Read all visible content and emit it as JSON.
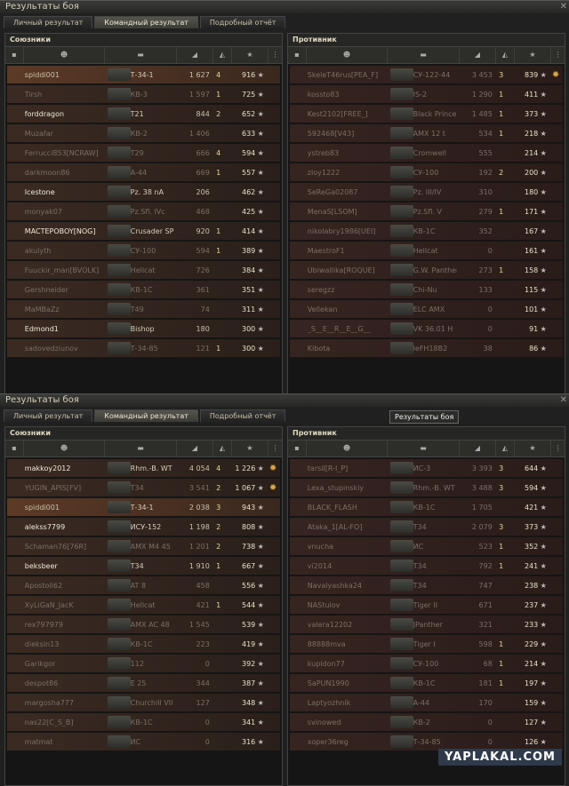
{
  "window_title": "Результаты боя",
  "tabs": [
    "Личный результат",
    "Командный результат",
    "Подробный отчёт"
  ],
  "allies_label": "Союзники",
  "enemies_label": "Противник",
  "tooltip": "Результаты боя",
  "watermark": "YAPLAKAL.COM",
  "battles": [
    {
      "allies": [
        {
          "name": "spiddi001",
          "tank": "Т-34-1",
          "dmg": "1 627",
          "kills": "4",
          "xp": "916",
          "state": "me"
        },
        {
          "name": "Tirsh",
          "tank": "КВ-3",
          "dmg": "1 597",
          "kills": "1",
          "xp": "725",
          "state": "dead"
        },
        {
          "name": "forddragon",
          "tank": "T21",
          "dmg": "844",
          "kills": "2",
          "xp": "652",
          "state": "alive"
        },
        {
          "name": "Muzafar",
          "tank": "КВ-2",
          "dmg": "1 406",
          "kills": "",
          "xp": "633",
          "state": "dead"
        },
        {
          "name": "Ferrucci853[NCRAW]",
          "tank": "T29",
          "dmg": "666",
          "kills": "4",
          "xp": "594",
          "state": "dead"
        },
        {
          "name": "darkmoon86",
          "tank": "A-44",
          "dmg": "669",
          "kills": "1",
          "xp": "557",
          "state": "dead"
        },
        {
          "name": "Icestone",
          "tank": "Pz. 38 nA",
          "dmg": "206",
          "kills": "",
          "xp": "462",
          "state": "alive"
        },
        {
          "name": "monyak07",
          "tank": "Pz.Sfl. IVc",
          "dmg": "468",
          "kills": "",
          "xp": "425",
          "state": "dead"
        },
        {
          "name": "MACTEPOBOY[NOG]",
          "tank": "Crusader SP",
          "dmg": "920",
          "kills": "1",
          "xp": "414",
          "state": "alive"
        },
        {
          "name": "akulyth",
          "tank": "СУ-100",
          "dmg": "594",
          "kills": "1",
          "xp": "389",
          "state": "dead"
        },
        {
          "name": "Fuuckir_man[BVOLK]",
          "tank": "Hellcat",
          "dmg": "726",
          "kills": "",
          "xp": "384",
          "state": "dead"
        },
        {
          "name": "Gershneider",
          "tank": "КВ-1С",
          "dmg": "361",
          "kills": "",
          "xp": "351",
          "state": "dead"
        },
        {
          "name": "MaMBaZz",
          "tank": "T49",
          "dmg": "74",
          "kills": "",
          "xp": "311",
          "state": "dead"
        },
        {
          "name": "Edmond1",
          "tank": "Bishop",
          "dmg": "180",
          "kills": "",
          "xp": "300",
          "state": "alive"
        },
        {
          "name": "sadovedziunov",
          "tank": "Т-34-85",
          "dmg": "121",
          "kills": "1",
          "xp": "300",
          "state": "dead"
        }
      ],
      "enemies": [
        {
          "name": "SkeleT46rus[PEA_F]",
          "tank": "СУ-122-44",
          "dmg": "3 453",
          "kills": "3",
          "xp": "839",
          "state": "dead",
          "medal": true
        },
        {
          "name": "kossto83",
          "tank": "IS-2",
          "dmg": "1 290",
          "kills": "1",
          "xp": "411",
          "state": "dead"
        },
        {
          "name": "Kest2102[FREE_]",
          "tank": "Black Prince",
          "dmg": "1 485",
          "kills": "1",
          "xp": "373",
          "state": "dead"
        },
        {
          "name": "592468[V43]",
          "tank": "AMX 12 t",
          "dmg": "534",
          "kills": "1",
          "xp": "218",
          "state": "dead"
        },
        {
          "name": "ystreb83",
          "tank": "Cromwell",
          "dmg": "555",
          "kills": "",
          "xp": "214",
          "state": "dead"
        },
        {
          "name": "zloy1222",
          "tank": "СУ-100",
          "dmg": "192",
          "kills": "2",
          "xp": "200",
          "state": "dead"
        },
        {
          "name": "SeReGa02087",
          "tank": "Pz. III/IV",
          "dmg": "310",
          "kills": "",
          "xp": "180",
          "state": "dead"
        },
        {
          "name": "MenaS[LSOM]",
          "tank": "Pz.Sfl. V",
          "dmg": "279",
          "kills": "1",
          "xp": "171",
          "state": "dead"
        },
        {
          "name": "nikolabry1986[UEI]",
          "tank": "КВ-1С",
          "dmg": "352",
          "kills": "",
          "xp": "167",
          "state": "dead"
        },
        {
          "name": "MaestroF1",
          "tank": "Hellcat",
          "dmg": "0",
          "kills": "",
          "xp": "161",
          "state": "dead"
        },
        {
          "name": "Ubiwallika[ROQUE]",
          "tank": "G.W. Panther",
          "dmg": "273",
          "kills": "1",
          "xp": "158",
          "state": "dead"
        },
        {
          "name": "seregzz",
          "tank": "Chi-Nu",
          "dmg": "133",
          "kills": "",
          "xp": "115",
          "state": "dead"
        },
        {
          "name": "Vellekan",
          "tank": "ELC AMX",
          "dmg": "0",
          "kills": "",
          "xp": "101",
          "state": "dead"
        },
        {
          "name": "_S__E__R__E__G__",
          "tank": "VK 36.01 H",
          "dmg": "0",
          "kills": "",
          "xp": "91",
          "state": "dead"
        },
        {
          "name": "Kibota",
          "tank": "leFH18B2",
          "dmg": "38",
          "kills": "",
          "xp": "86",
          "state": "dead"
        }
      ]
    },
    {
      "allies": [
        {
          "name": "makkoy2012",
          "tank": "Rhm.-B. WT",
          "dmg": "4 054",
          "kills": "4",
          "xp": "1 226",
          "state": "alive",
          "medal": true
        },
        {
          "name": "YUGIN_APIS[FV]",
          "tank": "T34",
          "dmg": "3 541",
          "kills": "2",
          "xp": "1 067",
          "state": "dead",
          "medal": true
        },
        {
          "name": "spiddi001",
          "tank": "Т-34-1",
          "dmg": "2 038",
          "kills": "3",
          "xp": "943",
          "state": "me"
        },
        {
          "name": "alekss7799",
          "tank": "ИСУ-152",
          "dmg": "1 198",
          "kills": "2",
          "xp": "808",
          "state": "alive"
        },
        {
          "name": "Schaman76[76R]",
          "tank": "AMX M4 45",
          "dmg": "1 201",
          "kills": "2",
          "xp": "738",
          "state": "dead"
        },
        {
          "name": "beksbeer",
          "tank": "T34",
          "dmg": "1 910",
          "kills": "1",
          "xp": "667",
          "state": "alive"
        },
        {
          "name": "Apostoll62",
          "tank": "AT 8",
          "dmg": "458",
          "kills": "",
          "xp": "556",
          "state": "dead"
        },
        {
          "name": "XyLiGaN_JacK",
          "tank": "Hellcat",
          "dmg": "421",
          "kills": "1",
          "xp": "544",
          "state": "dead"
        },
        {
          "name": "rex797979",
          "tank": "AMX AC 48",
          "dmg": "1 545",
          "kills": "",
          "xp": "539",
          "state": "dead"
        },
        {
          "name": "dieksin13",
          "tank": "КВ-1С",
          "dmg": "223",
          "kills": "",
          "xp": "419",
          "state": "dead"
        },
        {
          "name": "Garikgor",
          "tank": "112",
          "dmg": "0",
          "kills": "",
          "xp": "392",
          "state": "dead"
        },
        {
          "name": "despot86",
          "tank": "E 25",
          "dmg": "344",
          "kills": "",
          "xp": "387",
          "state": "dead"
        },
        {
          "name": "margosha777",
          "tank": "Churchill VII",
          "dmg": "127",
          "kills": "",
          "xp": "348",
          "state": "dead"
        },
        {
          "name": "nas22[C_S_B]",
          "tank": "КВ-1С",
          "dmg": "0",
          "kills": "",
          "xp": "341",
          "state": "dead"
        },
        {
          "name": "matmat",
          "tank": "ИС",
          "dmg": "0",
          "kills": "",
          "xp": "316",
          "state": "dead"
        }
      ],
      "enemies": [
        {
          "name": "tarsil[R-I_P]",
          "tank": "ИС-3",
          "dmg": "3 393",
          "kills": "3",
          "xp": "644",
          "state": "dead"
        },
        {
          "name": "Lexa_stupinskiy",
          "tank": "Rhm.-B. WT",
          "dmg": "3 488",
          "kills": "3",
          "xp": "594",
          "state": "dead"
        },
        {
          "name": "BLACK_FLASH",
          "tank": "КВ-1С",
          "dmg": "1 705",
          "kills": "",
          "xp": "421",
          "state": "dead"
        },
        {
          "name": "Ataka_1[AL-FO]",
          "tank": "T34",
          "dmg": "2 079",
          "kills": "3",
          "xp": "373",
          "state": "dead"
        },
        {
          "name": "vnucha",
          "tank": "ИС",
          "dmg": "523",
          "kills": "1",
          "xp": "352",
          "state": "dead"
        },
        {
          "name": "vi2014",
          "tank": "T34",
          "dmg": "792",
          "kills": "1",
          "xp": "241",
          "state": "dead"
        },
        {
          "name": "Navalyashka24",
          "tank": "T34",
          "dmg": "747",
          "kills": "",
          "xp": "238",
          "state": "dead"
        },
        {
          "name": "NAStulov",
          "tank": "Tiger II",
          "dmg": "671",
          "kills": "",
          "xp": "237",
          "state": "dead"
        },
        {
          "name": "valera12202",
          "tank": "JPanther",
          "dmg": "321",
          "kills": "",
          "xp": "233",
          "state": "dead"
        },
        {
          "name": "88888mva",
          "tank": "Tiger I",
          "dmg": "598",
          "kills": "1",
          "xp": "229",
          "state": "dead"
        },
        {
          "name": "kupidon77",
          "tank": "СУ-100",
          "dmg": "68",
          "kills": "1",
          "xp": "214",
          "state": "dead"
        },
        {
          "name": "SaPUN1990",
          "tank": "КВ-1С",
          "dmg": "181",
          "kills": "1",
          "xp": "197",
          "state": "dead"
        },
        {
          "name": "Laptyozhnik",
          "tank": "A-44",
          "dmg": "170",
          "kills": "",
          "xp": "159",
          "state": "dead"
        },
        {
          "name": "svinowed",
          "tank": "КВ-2",
          "dmg": "0",
          "kills": "",
          "xp": "127",
          "state": "dead"
        },
        {
          "name": "xoper36reg",
          "tank": "Т-34-85",
          "dmg": "0",
          "kills": "",
          "xp": "126",
          "state": "dead"
        }
      ]
    }
  ]
}
